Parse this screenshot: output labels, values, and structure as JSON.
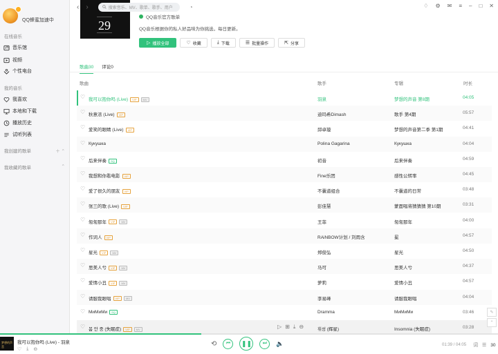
{
  "sidebar": {
    "profile_name": "QQ蜂蜜加速中",
    "online_music_title": "在线音乐",
    "online_items": [
      {
        "label": "音乐馆",
        "icon": "music-hall-icon"
      },
      {
        "label": "视频",
        "icon": "video-icon"
      },
      {
        "label": "个性电台",
        "icon": "radio-icon"
      }
    ],
    "my_music_title": "我的音乐",
    "my_items": [
      {
        "label": "我喜欢",
        "icon": "heart-icon"
      },
      {
        "label": "本地和下载",
        "icon": "computer-icon"
      },
      {
        "label": "播放历史",
        "icon": "history-icon"
      },
      {
        "label": "试听列表",
        "icon": "list-icon"
      }
    ],
    "created_playlists": "我创建的歌单",
    "collected_playlists": "我收藏的歌单"
  },
  "topbar": {
    "search_placeholder": "搜索音乐、MV、歌单、歌手、用户"
  },
  "playlist": {
    "cover_day": "29",
    "title": "QQ音乐官方歌单",
    "description": "QQ音乐根据你的私人好品味为你挑选，每日更新。",
    "play_all": "播放全部",
    "favorite": "收藏",
    "download": "下载",
    "batch": "批量操作",
    "share": "分享"
  },
  "tabs": [
    {
      "label": "歌曲30",
      "active": true
    },
    {
      "label": "评论0",
      "active": false
    }
  ],
  "columns": {
    "song": "歌曲",
    "artist": "歌手",
    "album": "专辑",
    "duration": "时长"
  },
  "songs": [
    {
      "title": "我可以抱你吗 (Live)",
      "tags": [
        "vip",
        "mv"
      ],
      "artist": "羽泉",
      "album": "梦想的声音 第8期",
      "duration": "04:05",
      "playing": true
    },
    {
      "title": "秋意浓 (Live)",
      "tags": [
        "vip"
      ],
      "artist": "迪玛希Dimash",
      "album": "歌手 第4期",
      "duration": "05:57"
    },
    {
      "title": "爱笑的眼睛 (Live)",
      "tags": [
        "vip"
      ],
      "artist": "邱卓璇",
      "album": "梦想的声音第二季 第1期",
      "duration": "04:41"
    },
    {
      "title": "Кукушка",
      "tags": [],
      "artist": "Polina Gagarina",
      "album": "Кукушка",
      "duration": "04:04"
    },
    {
      "title": "后来伴奏",
      "tags": [
        "sq"
      ],
      "artist": "初音",
      "album": "后来伴奏",
      "duration": "04:59"
    },
    {
      "title": "我想和你看电影",
      "tags": [
        "vip"
      ],
      "artist": "Fine乐团",
      "album": "感性公转率",
      "duration": "04:45"
    },
    {
      "title": "爱了很久的朋友",
      "tags": [
        "vip"
      ],
      "artist": "不囊道组合",
      "album": "不囊道的日常",
      "duration": "03:48"
    },
    {
      "title": "张三的歌 (Live)",
      "tags": [
        "vip"
      ],
      "artist": "彭佳慧",
      "album": "蒙面唱将猜猜猜 第10期",
      "duration": "03:31"
    },
    {
      "title": "匆匆那年",
      "tags": [
        "vip",
        "mv"
      ],
      "artist": "王菲",
      "album": "匆匆那年",
      "duration": "04:00"
    },
    {
      "title": "作词人",
      "tags": [
        "vip"
      ],
      "artist": "RAiNBOW计划 / 刘雨含",
      "album": "冕",
      "duration": "04:57"
    },
    {
      "title": "星光",
      "tags": [
        "vip",
        "mv"
      ],
      "artist": "郑俊弘",
      "album": "星光",
      "duration": "04:50"
    },
    {
      "title": "思美人兮",
      "tags": [
        "vip",
        "mv"
      ],
      "artist": "马可",
      "album": "思美人兮",
      "duration": "04:37"
    },
    {
      "title": "爱情小丑",
      "tags": [
        "vip",
        "mv"
      ],
      "artist": "萝莉",
      "album": "爱情小丑",
      "duration": "04:57"
    },
    {
      "title": "请服我眼唱",
      "tags": [
        "vip",
        "mv"
      ],
      "artist": "李易峰",
      "album": "请服我眼唱",
      "duration": "04:04"
    },
    {
      "title": "МиМиМи",
      "tags": [
        "sq"
      ],
      "artist": "Dramma",
      "album": "МиМиМи",
      "duration": "03:46"
    },
    {
      "title": "봄 안 중 (失眠症)",
      "tags": [
        "vip",
        "mv"
      ],
      "artist": "휘성 (辉星)",
      "album": "Insomnia (失眠症)",
      "duration": "03:28",
      "hover": true
    }
  ],
  "tag_labels": {
    "vip": "VIP",
    "sq": "SQ",
    "mv": "MV"
  },
  "player": {
    "cover_text": "梦想的声音",
    "song": "我可以抱你吗 (Live) - 羽泉",
    "time": "01:39 / 04:05",
    "progress": 0.404,
    "count": "30"
  },
  "floating": {
    "a": "反馈",
    "b": "TOP"
  },
  "colors": {
    "accent": "#31c27c",
    "vip": "#e6a23c"
  }
}
